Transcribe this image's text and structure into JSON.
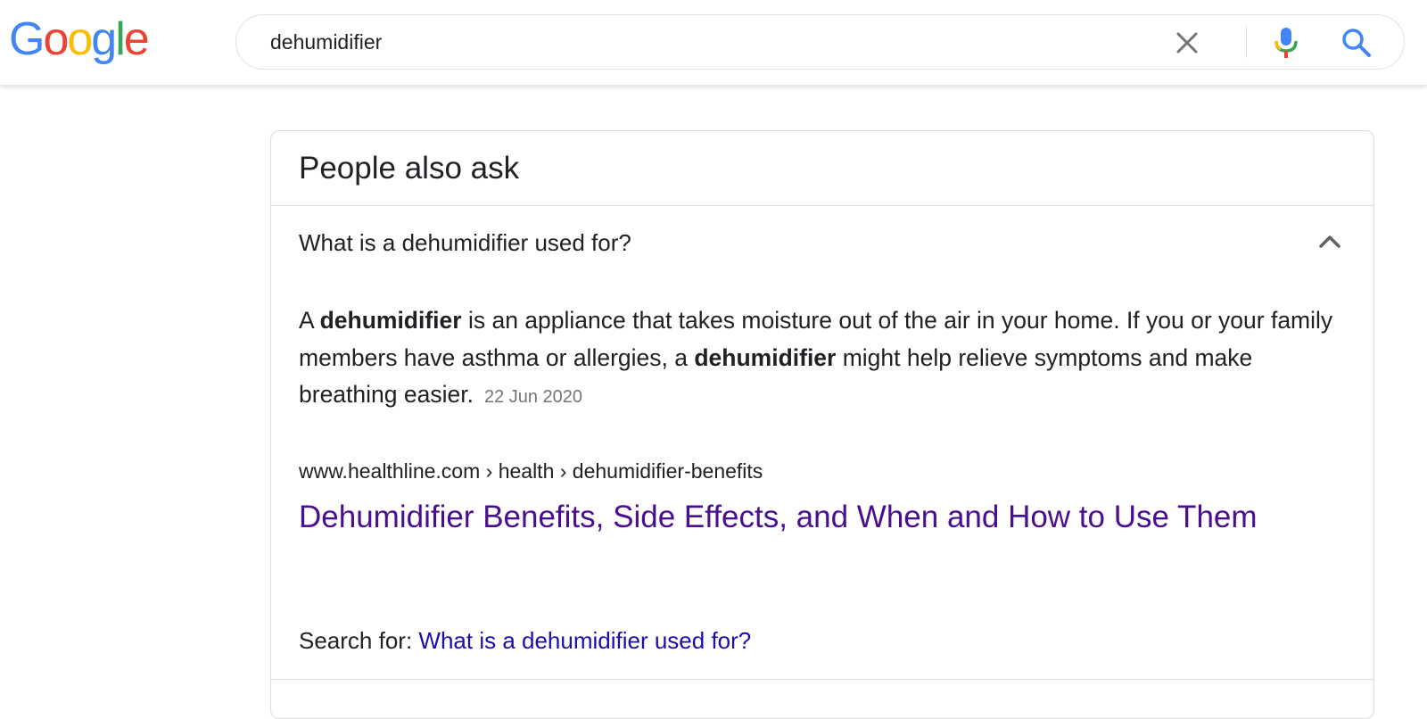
{
  "header": {
    "logo": {
      "letters": [
        "G",
        "o",
        "o",
        "g",
        "l",
        "e"
      ],
      "colors": [
        "#4285F4",
        "#EA4335",
        "#FBBC05",
        "#4285F4",
        "#34A853",
        "#EA4335"
      ]
    },
    "search": {
      "value": "dehumidifier",
      "clear_icon": "close-icon",
      "mic_icon": "microphone-icon",
      "search_icon": "search-icon"
    }
  },
  "people_also_ask": {
    "title": "People also ask",
    "question": "What is a dehumidifier used for?",
    "expanded_icon": "chevron-up-icon",
    "answer": {
      "part1": "A ",
      "bold1": "dehumidifier",
      "part2": " is an appliance that takes moisture out of the air in your home. If you or your family members have asthma or allergies, a ",
      "bold2": "dehumidifier",
      "part3": " might help relieve symptoms and make breathing easier.",
      "date": "22 Jun 2020"
    },
    "source": {
      "breadcrumb": "www.healthline.com › health › dehumidifier-benefits",
      "title": "Dehumidifier Benefits, Side Effects, and When and How to Use Them"
    },
    "search_for": {
      "label": "Search for: ",
      "link": "What is a dehumidifier used for?"
    }
  },
  "colors": {
    "visited_link": "#4a0f8f",
    "link": "#1a0dab",
    "text": "#202124",
    "muted": "#70757a",
    "border": "#dadce0"
  }
}
